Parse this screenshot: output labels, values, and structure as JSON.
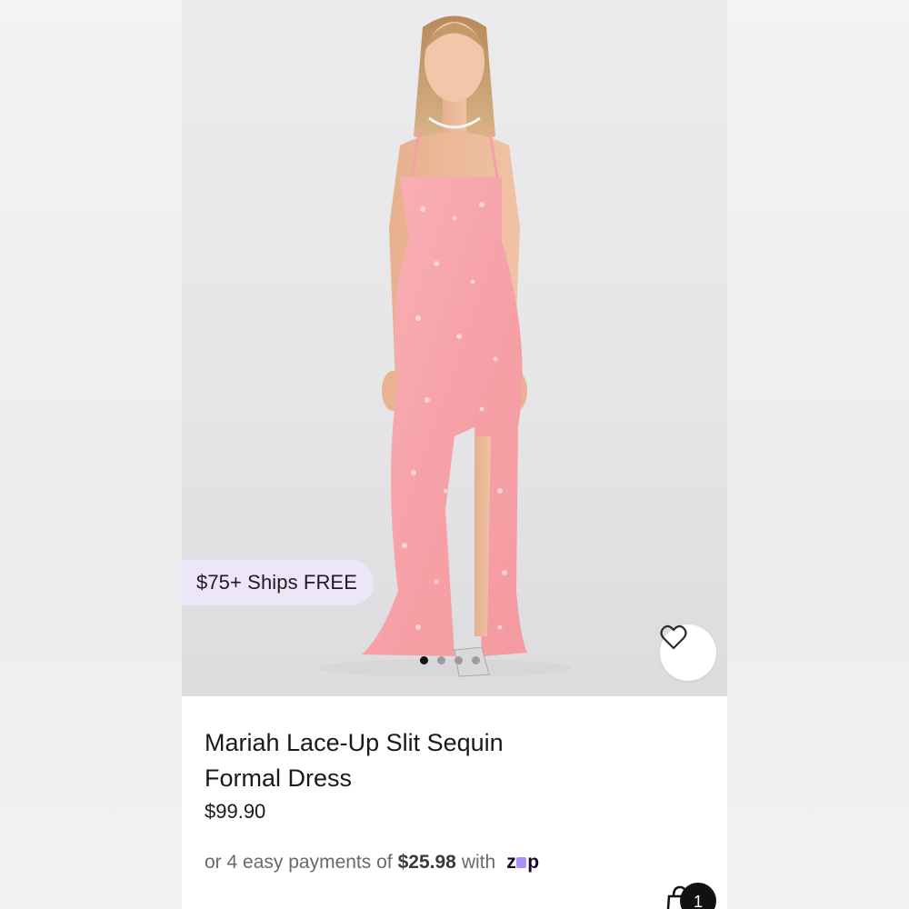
{
  "product": {
    "shipping_badge": "$75+ Ships FREE",
    "title": "Mariah Lace-Up Slit Sequin Formal Dress",
    "price": "$99.90",
    "installments": {
      "prefix": "or 4 easy payments of",
      "amount": "$25.98",
      "suffix": "with",
      "provider_logo": "zip"
    },
    "dress_color": "#f7a8ad",
    "accent_color": "#ece6f8"
  },
  "gallery": {
    "dot_count": 4,
    "active_dot": 1
  },
  "icons": {
    "favorite": "heart-outline-icon",
    "bag": "shopping-bag-icon"
  },
  "cart": {
    "count": "1"
  }
}
